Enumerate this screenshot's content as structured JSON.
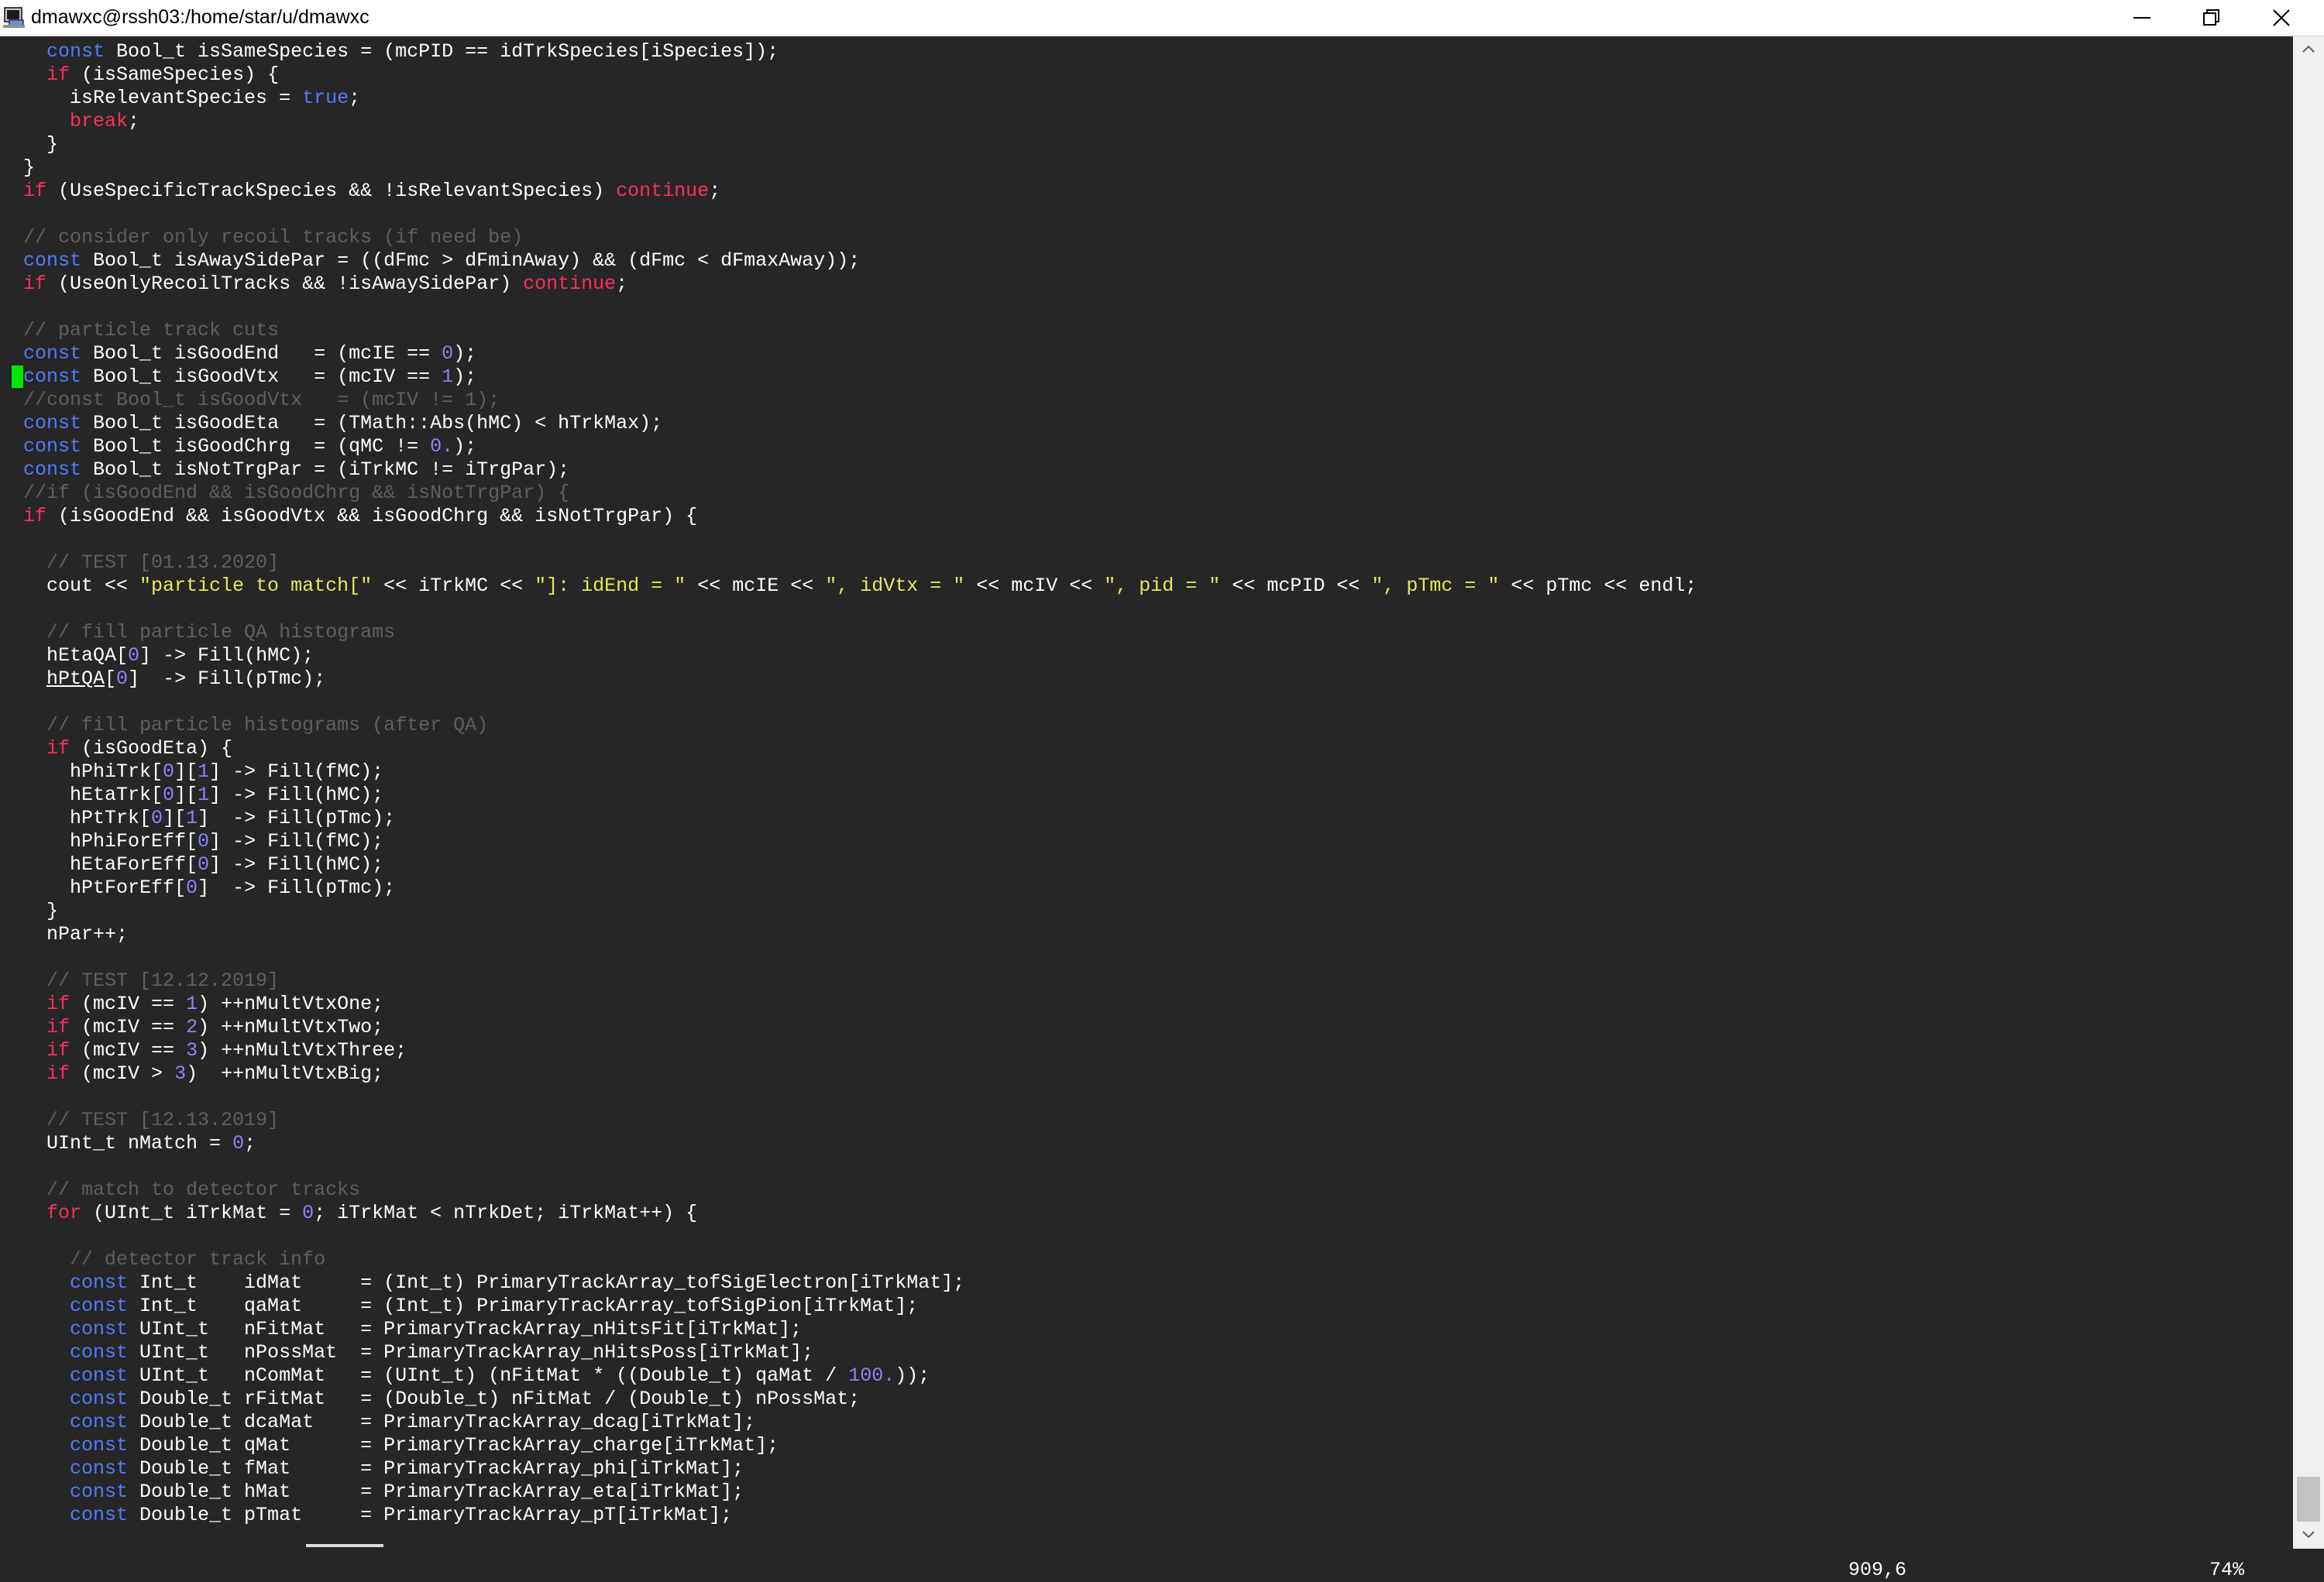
{
  "window": {
    "title": "dmawxc@rssh03:/home/star/u/dmawxc",
    "icons": {
      "app": "terminal-icon",
      "minimize": "minimize-icon",
      "maximize": "restore-icon",
      "close": "close-icon"
    },
    "colors": {
      "background": "#262626",
      "keyword": "#4f7dff",
      "control": "#ff2f5a",
      "number": "#8b83ff",
      "string": "#e5e85a",
      "comment": "#5f5f5f",
      "cursor": "#00e600"
    }
  },
  "editor": {
    "lines": [
      [
        {
          "t": "    "
        },
        {
          "t": "const",
          "c": "kw"
        },
        {
          "t": " Bool_t isSameSpecies = (mcPID == idTrkSpecies[iSpecies]);"
        }
      ],
      [
        {
          "t": "    "
        },
        {
          "t": "if",
          "c": "ctl"
        },
        {
          "t": " (isSameSpecies) {"
        }
      ],
      [
        {
          "t": "      isRelevantSpecies = "
        },
        {
          "t": "true",
          "c": "kw"
        },
        {
          "t": ";"
        }
      ],
      [
        {
          "t": "      "
        },
        {
          "t": "break",
          "c": "ctl"
        },
        {
          "t": ";"
        }
      ],
      [
        {
          "t": "    }"
        }
      ],
      [
        {
          "t": "  }"
        }
      ],
      [
        {
          "t": "  "
        },
        {
          "t": "if",
          "c": "ctl"
        },
        {
          "t": " (UseSpecificTrackSpecies && !isRelevantSpecies) "
        },
        {
          "t": "continue",
          "c": "ctl"
        },
        {
          "t": ";"
        }
      ],
      [
        {
          "t": ""
        }
      ],
      [
        {
          "t": "  "
        },
        {
          "t": "// consider only recoil tracks (if need be)",
          "c": "cm"
        }
      ],
      [
        {
          "t": "  "
        },
        {
          "t": "const",
          "c": "kw"
        },
        {
          "t": " Bool_t isAwaySidePar = ((dFmc > dFminAway) && (dFmc < dFmaxAway));"
        }
      ],
      [
        {
          "t": "  "
        },
        {
          "t": "if",
          "c": "ctl"
        },
        {
          "t": " (UseOnlyRecoilTracks && !isAwaySidePar) "
        },
        {
          "t": "continue",
          "c": "ctl"
        },
        {
          "t": ";"
        }
      ],
      [
        {
          "t": ""
        }
      ],
      [
        {
          "t": "  "
        },
        {
          "t": "// particle track cuts",
          "c": "cm"
        }
      ],
      [
        {
          "t": "  "
        },
        {
          "t": "const",
          "c": "kw"
        },
        {
          "t": " Bool_t isGoodEnd   = (mcIE == "
        },
        {
          "t": "0",
          "c": "num"
        },
        {
          "t": ");"
        }
      ],
      [
        {
          "t": " "
        },
        {
          "t": " ",
          "c": "cursor"
        },
        {
          "t": "const",
          "c": "kw"
        },
        {
          "t": " Bool_t isGoodVtx   = (mcIV == "
        },
        {
          "t": "1",
          "c": "num"
        },
        {
          "t": ");"
        }
      ],
      [
        {
          "t": "  "
        },
        {
          "t": "//const Bool_t isGoodVtx   = (mcIV != 1);",
          "c": "cm"
        }
      ],
      [
        {
          "t": "  "
        },
        {
          "t": "const",
          "c": "kw"
        },
        {
          "t": " Bool_t isGoodEta   = (TMath::Abs(hMC) < hTrkMax);"
        }
      ],
      [
        {
          "t": "  "
        },
        {
          "t": "const",
          "c": "kw"
        },
        {
          "t": " Bool_t isGoodChrg  = (qMC != "
        },
        {
          "t": "0.",
          "c": "num"
        },
        {
          "t": ");"
        }
      ],
      [
        {
          "t": "  "
        },
        {
          "t": "const",
          "c": "kw"
        },
        {
          "t": " Bool_t isNotTrgPar = (iTrkMC != iTrgPar);"
        }
      ],
      [
        {
          "t": "  "
        },
        {
          "t": "//if (isGoodEnd && isGoodChrg && isNotTrgPar) {",
          "c": "cm"
        }
      ],
      [
        {
          "t": "  "
        },
        {
          "t": "if",
          "c": "ctl"
        },
        {
          "t": " (isGoodEnd && isGoodVtx && isGoodChrg && isNotTrgPar) {"
        }
      ],
      [
        {
          "t": ""
        }
      ],
      [
        {
          "t": "    "
        },
        {
          "t": "// TEST [01.13.2020]",
          "c": "cm"
        }
      ],
      [
        {
          "t": "    cout << "
        },
        {
          "t": "\"particle to match[\"",
          "c": "str"
        },
        {
          "t": " << iTrkMC << "
        },
        {
          "t": "\"]: idEnd = \"",
          "c": "str"
        },
        {
          "t": " << mcIE << "
        },
        {
          "t": "\", idVtx = \"",
          "c": "str"
        },
        {
          "t": " << mcIV << "
        },
        {
          "t": "\", pid = \"",
          "c": "str"
        },
        {
          "t": " << mcPID << "
        },
        {
          "t": "\", pTmc = \"",
          "c": "str"
        },
        {
          "t": " << pTmc << endl;"
        }
      ],
      [
        {
          "t": ""
        }
      ],
      [
        {
          "t": "    "
        },
        {
          "t": "// fill particle QA histograms",
          "c": "cm"
        }
      ],
      [
        {
          "t": "    hEtaQA["
        },
        {
          "t": "0",
          "c": "num"
        },
        {
          "t": "] -> Fill(hMC);"
        }
      ],
      [
        {
          "t": "    "
        },
        {
          "t": "hPtQA",
          "c": "ul"
        },
        {
          "t": "["
        },
        {
          "t": "0",
          "c": "num"
        },
        {
          "t": "]  -> Fill(pTmc);"
        }
      ],
      [
        {
          "t": ""
        }
      ],
      [
        {
          "t": "    "
        },
        {
          "t": "// fill particle histograms (after QA)",
          "c": "cm"
        }
      ],
      [
        {
          "t": "    "
        },
        {
          "t": "if",
          "c": "ctl"
        },
        {
          "t": " (isGoodEta) {"
        }
      ],
      [
        {
          "t": "      hPhiTrk["
        },
        {
          "t": "0",
          "c": "num"
        },
        {
          "t": "]["
        },
        {
          "t": "1",
          "c": "num"
        },
        {
          "t": "] -> Fill(fMC);"
        }
      ],
      [
        {
          "t": "      hEtaTrk["
        },
        {
          "t": "0",
          "c": "num"
        },
        {
          "t": "]["
        },
        {
          "t": "1",
          "c": "num"
        },
        {
          "t": "] -> Fill(hMC);"
        }
      ],
      [
        {
          "t": "      hPtTrk["
        },
        {
          "t": "0",
          "c": "num"
        },
        {
          "t": "]["
        },
        {
          "t": "1",
          "c": "num"
        },
        {
          "t": "]  -> Fill(pTmc);"
        }
      ],
      [
        {
          "t": "      hPhiForEff["
        },
        {
          "t": "0",
          "c": "num"
        },
        {
          "t": "] -> Fill(fMC);"
        }
      ],
      [
        {
          "t": "      hEtaForEff["
        },
        {
          "t": "0",
          "c": "num"
        },
        {
          "t": "] -> Fill(hMC);"
        }
      ],
      [
        {
          "t": "      hPtForEff["
        },
        {
          "t": "0",
          "c": "num"
        },
        {
          "t": "]  -> Fill(pTmc);"
        }
      ],
      [
        {
          "t": "    }"
        }
      ],
      [
        {
          "t": "    nPar++;"
        }
      ],
      [
        {
          "t": ""
        }
      ],
      [
        {
          "t": "    "
        },
        {
          "t": "// TEST [12.12.2019]",
          "c": "cm"
        }
      ],
      [
        {
          "t": "    "
        },
        {
          "t": "if",
          "c": "ctl"
        },
        {
          "t": " (mcIV == "
        },
        {
          "t": "1",
          "c": "num"
        },
        {
          "t": ") ++nMultVtxOne;"
        }
      ],
      [
        {
          "t": "    "
        },
        {
          "t": "if",
          "c": "ctl"
        },
        {
          "t": " (mcIV == "
        },
        {
          "t": "2",
          "c": "num"
        },
        {
          "t": ") ++nMultVtxTwo;"
        }
      ],
      [
        {
          "t": "    "
        },
        {
          "t": "if",
          "c": "ctl"
        },
        {
          "t": " (mcIV == "
        },
        {
          "t": "3",
          "c": "num"
        },
        {
          "t": ") ++nMultVtxThree;"
        }
      ],
      [
        {
          "t": "    "
        },
        {
          "t": "if",
          "c": "ctl"
        },
        {
          "t": " (mcIV > "
        },
        {
          "t": "3",
          "c": "num"
        },
        {
          "t": ")  ++nMultVtxBig;"
        }
      ],
      [
        {
          "t": ""
        }
      ],
      [
        {
          "t": "    "
        },
        {
          "t": "// TEST [12.13.2019]",
          "c": "cm"
        }
      ],
      [
        {
          "t": "    UInt_t nMatch = "
        },
        {
          "t": "0",
          "c": "num"
        },
        {
          "t": ";"
        }
      ],
      [
        {
          "t": ""
        }
      ],
      [
        {
          "t": "    "
        },
        {
          "t": "// match to detector tracks",
          "c": "cm"
        }
      ],
      [
        {
          "t": "    "
        },
        {
          "t": "for",
          "c": "ctl"
        },
        {
          "t": " (UInt_t iTrkMat = "
        },
        {
          "t": "0",
          "c": "num"
        },
        {
          "t": "; iTrkMat < nTrkDet; iTrkMat++) {"
        }
      ],
      [
        {
          "t": ""
        }
      ],
      [
        {
          "t": "      "
        },
        {
          "t": "// detector track info",
          "c": "cm"
        }
      ],
      [
        {
          "t": "      "
        },
        {
          "t": "const",
          "c": "kw"
        },
        {
          "t": " Int_t    idMat     = (Int_t) PrimaryTrackArray_tofSigElectron[iTrkMat];"
        }
      ],
      [
        {
          "t": "      "
        },
        {
          "t": "const",
          "c": "kw"
        },
        {
          "t": " Int_t    qaMat     = (Int_t) PrimaryTrackArray_tofSigPion[iTrkMat];"
        }
      ],
      [
        {
          "t": "      "
        },
        {
          "t": "const",
          "c": "kw"
        },
        {
          "t": " UInt_t   nFitMat   = PrimaryTrackArray_nHitsFit[iTrkMat];"
        }
      ],
      [
        {
          "t": "      "
        },
        {
          "t": "const",
          "c": "kw"
        },
        {
          "t": " UInt_t   nPossMat  = PrimaryTrackArray_nHitsPoss[iTrkMat];"
        }
      ],
      [
        {
          "t": "      "
        },
        {
          "t": "const",
          "c": "kw"
        },
        {
          "t": " UInt_t   nComMat   = (UInt_t) (nFitMat * ((Double_t) qaMat / "
        },
        {
          "t": "100.",
          "c": "num"
        },
        {
          "t": "));"
        }
      ],
      [
        {
          "t": "      "
        },
        {
          "t": "const",
          "c": "kw"
        },
        {
          "t": " Double_t rFitMat   = (Double_t) nFitMat / (Double_t) nPossMat;"
        }
      ],
      [
        {
          "t": "      "
        },
        {
          "t": "const",
          "c": "kw"
        },
        {
          "t": " Double_t dcaMat    = PrimaryTrackArray_dcag[iTrkMat];"
        }
      ],
      [
        {
          "t": "      "
        },
        {
          "t": "const",
          "c": "kw"
        },
        {
          "t": " Double_t qMat      = PrimaryTrackArray_charge[iTrkMat];"
        }
      ],
      [
        {
          "t": "      "
        },
        {
          "t": "const",
          "c": "kw"
        },
        {
          "t": " Double_t fMat      = PrimaryTrackArray_phi[iTrkMat];"
        }
      ],
      [
        {
          "t": "      "
        },
        {
          "t": "const",
          "c": "kw"
        },
        {
          "t": " Double_t hMat      = PrimaryTrackArray_eta[iTrkMat];"
        }
      ],
      [
        {
          "t": "      "
        },
        {
          "t": "const",
          "c": "kw"
        },
        {
          "t": " Double_t pTmat     = PrimaryTrackArray_pT[iTrkMat];"
        }
      ]
    ]
  },
  "status": {
    "position": "909,6",
    "percent": "74%"
  },
  "scrollbar": {
    "up_icon": "scroll-up-arrow-icon",
    "down_icon": "scroll-down-arrow-icon"
  }
}
